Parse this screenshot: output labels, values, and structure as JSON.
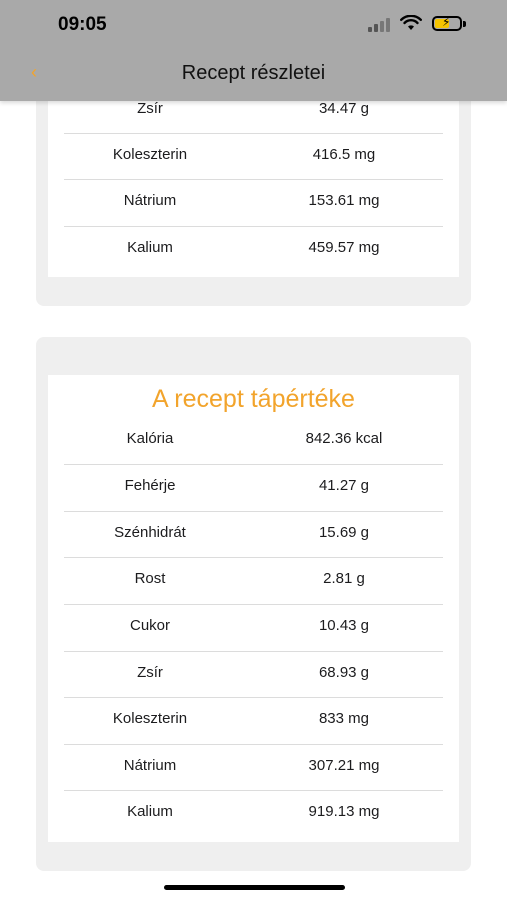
{
  "status_bar": {
    "time": "09:05"
  },
  "nav": {
    "title": "Recept részletei",
    "back_icon": "‹"
  },
  "top_card": {
    "rows": [
      {
        "name": "Zsír",
        "value": "34.47 g"
      },
      {
        "name": "Koleszterin",
        "value": "416.5 mg"
      },
      {
        "name": "Nátrium",
        "value": "153.61 mg"
      },
      {
        "name": "Kalium",
        "value": "459.57 mg"
      }
    ]
  },
  "recipe_card": {
    "title": "A recept tápértéke",
    "rows": [
      {
        "name": "Kalória",
        "value": "842.36 kcal"
      },
      {
        "name": "Fehérje",
        "value": "41.27 g"
      },
      {
        "name": "Szénhidrát",
        "value": "15.69 g"
      },
      {
        "name": "Rost",
        "value": "2.81 g"
      },
      {
        "name": "Cukor",
        "value": "10.43 g"
      },
      {
        "name": "Zsír",
        "value": "68.93 g"
      },
      {
        "name": "Koleszterin",
        "value": "833 mg"
      },
      {
        "name": "Nátrium",
        "value": "307.21 mg"
      },
      {
        "name": "Kalium",
        "value": "919.13 mg"
      }
    ]
  },
  "colors": {
    "accent": "#f2a42c",
    "header": "#a9a9a9",
    "card_bg": "#efefef",
    "battery": "#f5c400"
  }
}
